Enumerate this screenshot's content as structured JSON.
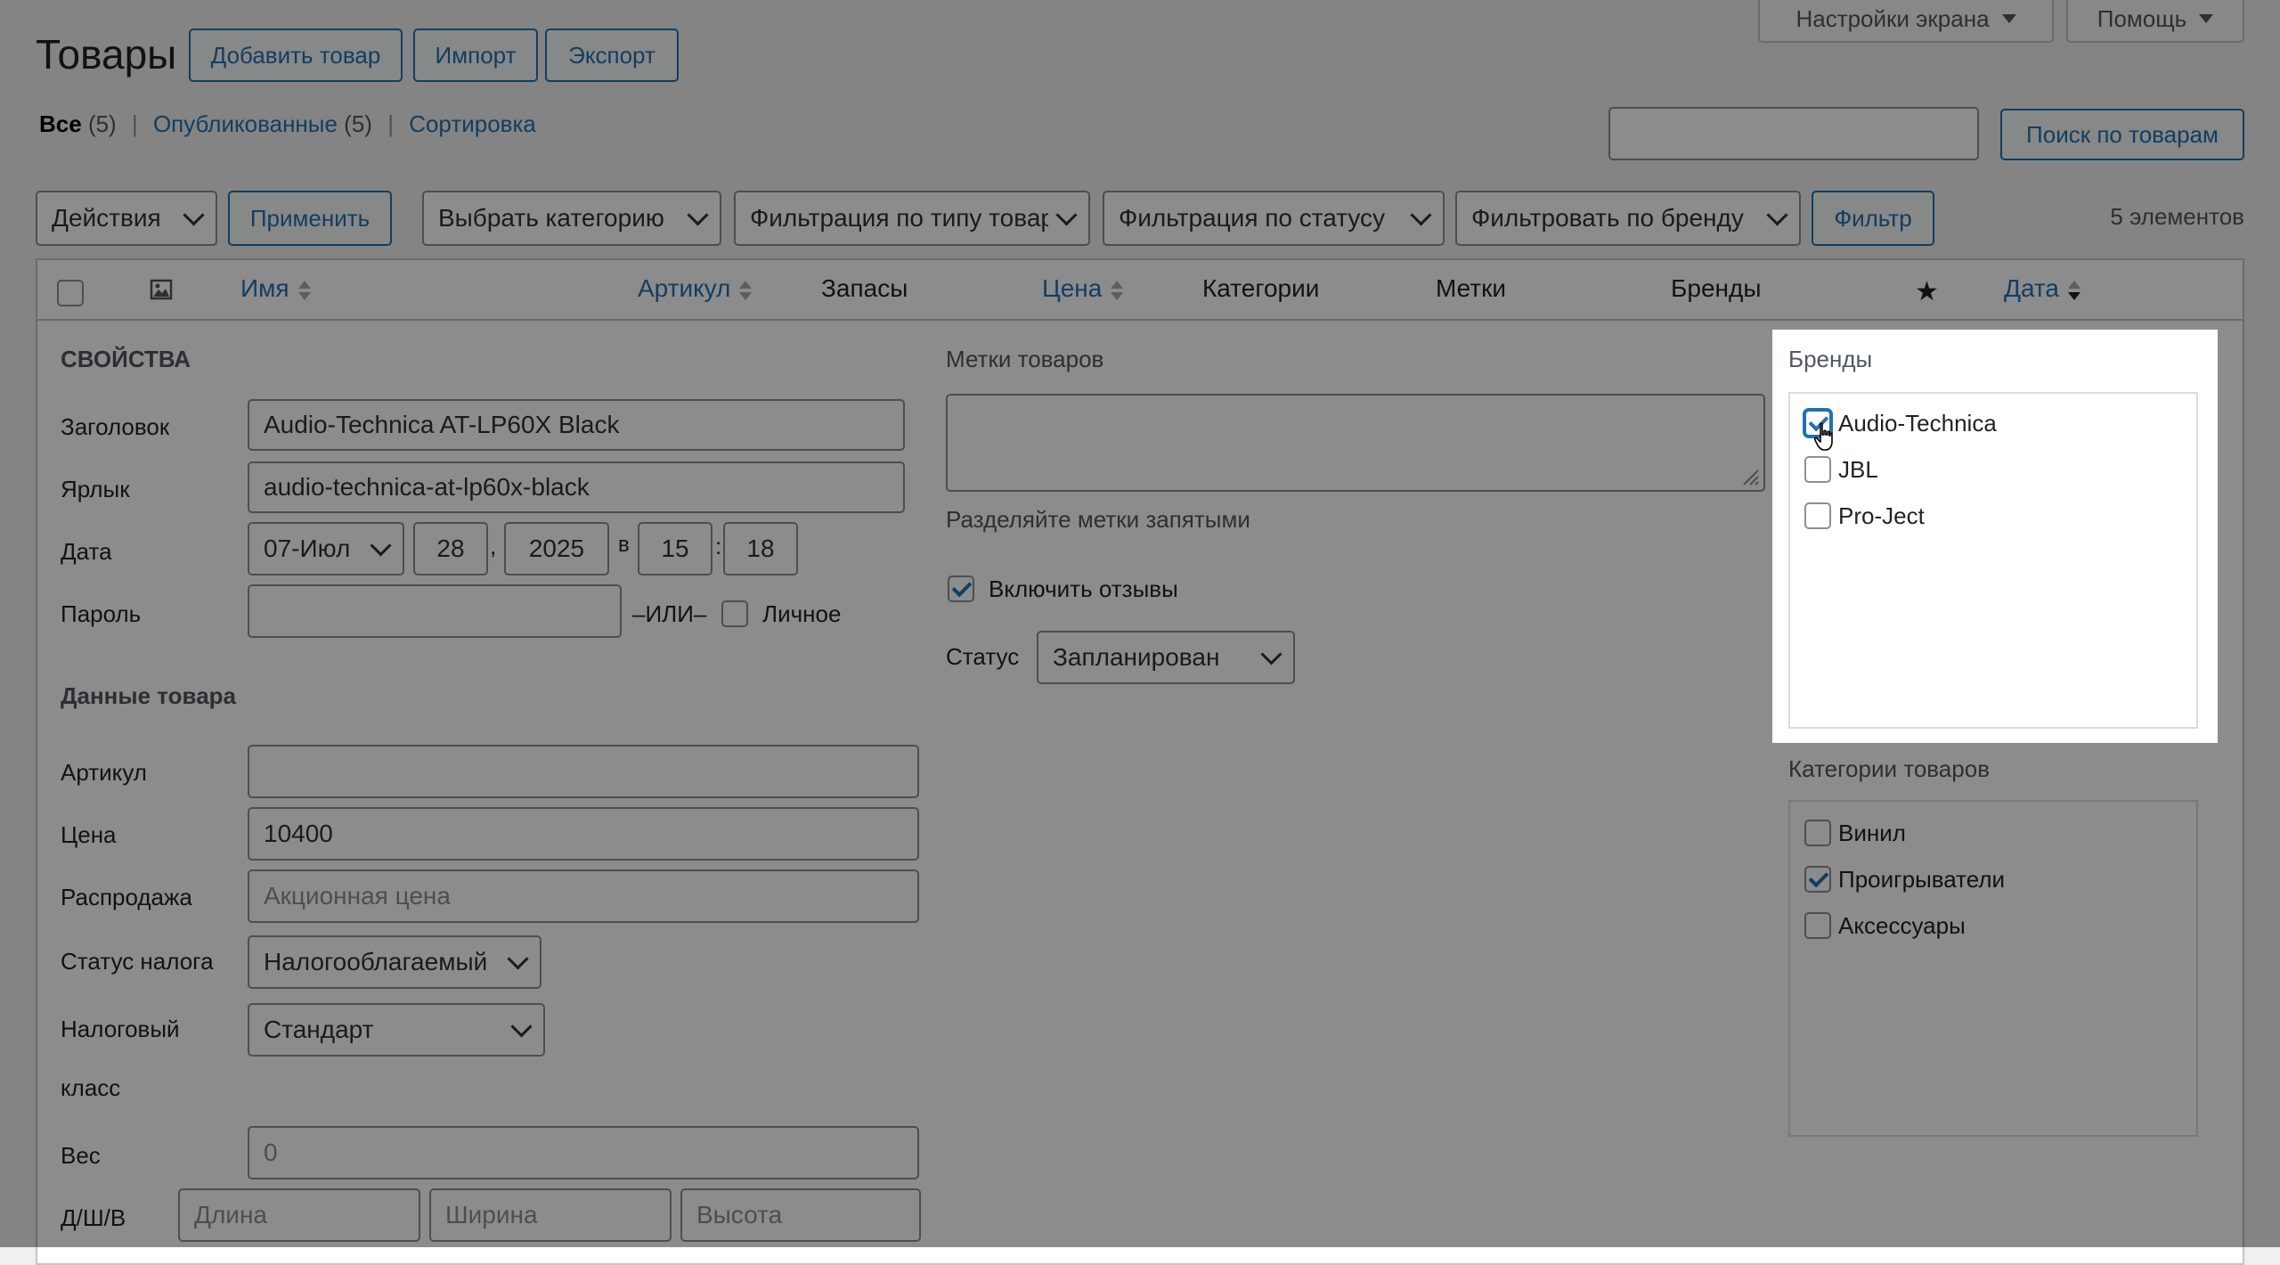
{
  "header": {
    "title": "Товары",
    "add_button": "Добавить товар",
    "import_button": "Импорт",
    "export_button": "Экспорт",
    "screen_options": "Настройки экрана",
    "help": "Помощь"
  },
  "subsubsub": {
    "all_label": "Все",
    "all_count": "(5)",
    "published_label": "Опубликованные",
    "published_count": "(5)",
    "sort_label": "Сортировка",
    "sep": "|"
  },
  "search": {
    "value": "",
    "button": "Поиск по товарам"
  },
  "filters": {
    "actions": "Действия",
    "apply": "Применить",
    "category": "Выбрать категорию",
    "type": "Фильтрация по типу товара",
    "status": "Фильтрация по статусу",
    "brand": "Фильтровать по бренду",
    "filter_button": "Фильтр",
    "items_count": "5 элементов"
  },
  "columns": {
    "name": "Имя",
    "sku": "Артикул",
    "stock": "Запасы",
    "price": "Цена",
    "categories": "Категории",
    "tags": "Метки",
    "brands": "Бренды",
    "date": "Дата"
  },
  "quick_edit": {
    "section_title": "СВОЙСТВА",
    "title_label": "Заголовок",
    "title_value": "Audio-Technica AT-LP60X Black",
    "slug_label": "Ярлык",
    "slug_value": "audio-technica-at-lp60x-black",
    "date_label": "Дата",
    "date_month": "07-Июл",
    "date_day": "28",
    "date_comma": ",",
    "date_year": "2025",
    "date_at": "в",
    "date_hour": "15",
    "date_colon": ":",
    "date_minute": "18",
    "password_label": "Пароль",
    "password_value": "",
    "or_label": "–ИЛИ–",
    "private_label": "Личное",
    "product_data_title": "Данные товара",
    "sku_label": "Артикул",
    "sku_value": "",
    "price_label": "Цена",
    "price_value": "10400",
    "sale_label": "Распродажа",
    "sale_placeholder": "Акционная цена",
    "tax_status_label": "Статус налога",
    "tax_status_value": "Налогооблагаемый",
    "tax_class_label_1": "Налоговый",
    "tax_class_label_2": "класс",
    "tax_class_value": "Стандарт",
    "weight_label": "Вес",
    "weight_placeholder": "0",
    "dims_label": "Д/Ш/В",
    "length_placeholder": "Длина",
    "width_placeholder": "Ширина",
    "height_placeholder": "Высота",
    "tags_title": "Метки товаров",
    "tags_hint": "Разделяйте метки запятыми",
    "reviews_label": "Включить отзывы",
    "status_label": "Статус",
    "status_value": "Запланирован"
  },
  "brands_panel": {
    "title": "Бренды",
    "items": [
      {
        "label": "Audio-Technica",
        "checked": true
      },
      {
        "label": "JBL",
        "checked": false
      },
      {
        "label": "Pro-Ject",
        "checked": false
      }
    ]
  },
  "categories_panel": {
    "title": "Категории товаров",
    "items": [
      {
        "label": "Винил",
        "checked": false
      },
      {
        "label": "Проигрыватели",
        "checked": true
      },
      {
        "label": "Аксессуары",
        "checked": false
      }
    ]
  },
  "icons": {
    "image_column": "image-icon",
    "featured_column": "star-icon",
    "cursor": "hand-pointer-icon"
  }
}
